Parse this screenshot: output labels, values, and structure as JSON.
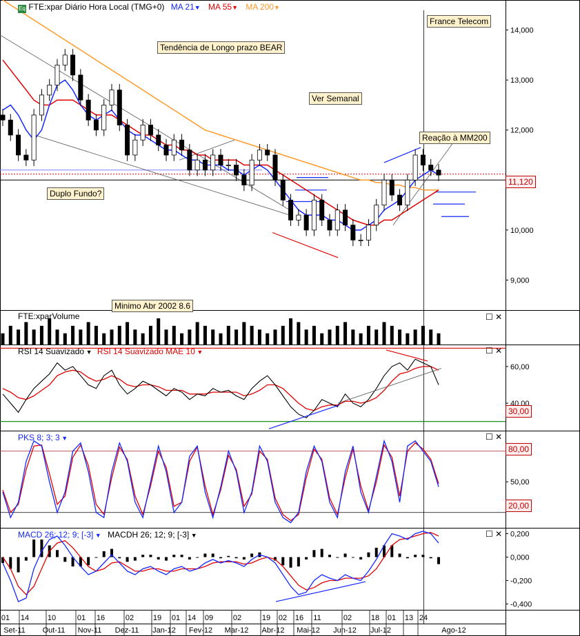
{
  "colors": {
    "ma21": "#1428ff",
    "ma55": "#e00000",
    "ma200": "#ff9a2a",
    "candle": "#000000",
    "note_bg": "#fff2cc",
    "price_tag_bg": "#ffecec",
    "price_tag_border": "#c00000",
    "rsi_main": "#000000",
    "rsi_signal": "#e00000",
    "pks_main": "#1428ff",
    "pks_signal": "#e00000",
    "macd_main": "#1428ff",
    "macd_signal": "#e00000",
    "level_red": "#e00000",
    "level_green": "#008000"
  },
  "header": {
    "instrument": "FTE:xpar Diário Hora Local (TMG+0)",
    "ma21": "MA 21",
    "ma55": "MA 55",
    "ma200": "MA 200"
  },
  "annotations": {
    "company": "France Telecom",
    "trend": "Tendência de Longo prazo BEAR",
    "weekly": "Ver Semanal",
    "reaction": "Reação à MM200",
    "double_bottom": "Duplo Fundo?",
    "minimum": "Minimo Abr 2002 8.6"
  },
  "price_tag": "11,120",
  "panels": {
    "volume": {
      "title": "FTE:xparVolume"
    },
    "rsi": {
      "title1": "RSI 14 Suavizado",
      "title2": "RSI 14 Suavizado MAE 10",
      "level_tag": "30,00"
    },
    "pks": {
      "title": "PKS 8; 3; 3",
      "tag_high": "80,00",
      "tag_low": "20,00"
    },
    "macd": {
      "title1": "MACD 26; 12; 9; [-3]",
      "title2": "MACDH 26; 12; 9; [-3]"
    }
  },
  "chart_data": [
    {
      "type": "line",
      "title": "FTE:xpar Diário Hora Local (TMG+0)",
      "chart": "candlestick",
      "y_axis_ticks": [
        "9,000",
        "10,000",
        "11,000",
        "12,000",
        "13,000",
        "14,000"
      ],
      "ylim": [
        8.4,
        14.6
      ],
      "last_price": 11.12,
      "x_day_ticks": [
        "01",
        "14",
        "10",
        "01",
        "16",
        "02",
        "19",
        "01",
        "14",
        "09",
        "02",
        "19",
        "02",
        "16",
        "11",
        "02",
        "18",
        "01",
        "13",
        "24"
      ],
      "x_month_ticks": [
        "Set-11",
        "Out-11",
        "Nov-11",
        "Dez-11",
        "Jan-12",
        "Fev-12",
        "Mar-12",
        "Abr-12",
        "Mai-12",
        "Jun-12",
        "Jul-12",
        "Ago-12"
      ],
      "series": [
        {
          "name": "MA 21"
        },
        {
          "name": "MA 55"
        },
        {
          "name": "MA 200"
        }
      ],
      "close_approx": [
        12.2,
        11.9,
        11.5,
        11.4,
        12.3,
        12.7,
        12.9,
        13.3,
        13.5,
        13.1,
        12.6,
        12.2,
        12.0,
        12.5,
        12.8,
        12.1,
        11.5,
        11.8,
        12.1,
        11.9,
        11.7,
        11.5,
        11.8,
        11.6,
        11.2,
        11.4,
        11.2,
        11.5,
        11.3,
        11.3,
        11.1,
        10.9,
        11.4,
        11.6,
        11.5,
        11.0,
        10.6,
        10.2,
        10.3,
        10.0,
        10.6,
        10.2,
        10.0,
        10.4,
        10.1,
        9.8,
        9.8,
        10.1,
        10.5,
        11.0,
        10.7,
        10.5,
        11.0,
        11.5,
        11.3,
        11.2,
        11.1
      ],
      "ma21_approx": [
        12.4,
        12.5,
        12.3,
        12.0,
        11.8,
        12.0,
        12.5,
        12.9,
        13.0,
        12.8,
        12.5,
        12.3,
        12.2,
        12.3,
        12.4,
        12.2,
        12.0,
        11.9,
        11.9,
        11.8,
        11.7,
        11.6,
        11.6,
        11.5,
        11.4,
        11.4,
        11.3,
        11.3,
        11.3,
        11.2,
        11.2,
        11.1,
        11.2,
        11.3,
        11.2,
        11.0,
        10.8,
        10.6,
        10.4,
        10.3,
        10.3,
        10.3,
        10.2,
        10.2,
        10.1,
        10.0,
        10.0,
        10.1,
        10.2,
        10.4,
        10.5,
        10.6,
        10.8,
        11.0,
        11.1,
        11.2,
        11.1
      ],
      "ma55_approx": [
        13.4,
        13.2,
        13.0,
        12.8,
        12.6,
        12.5,
        12.5,
        12.6,
        12.6,
        12.6,
        12.5,
        12.4,
        12.3,
        12.3,
        12.3,
        12.2,
        12.1,
        12.0,
        11.9,
        11.9,
        11.8,
        11.7,
        11.7,
        11.6,
        11.6,
        11.5,
        11.5,
        11.4,
        11.4,
        11.4,
        11.4,
        11.3,
        11.3,
        11.3,
        11.3,
        11.2,
        11.1,
        11.0,
        10.9,
        10.8,
        10.7,
        10.6,
        10.5,
        10.4,
        10.3,
        10.2,
        10.15,
        10.1,
        10.1,
        10.2,
        10.2,
        10.3,
        10.4,
        10.5,
        10.6,
        10.7,
        10.8
      ],
      "ma200_approx": [
        14.6,
        14.5,
        14.4,
        14.3,
        14.2,
        14.1,
        14.0,
        13.9,
        13.8,
        13.7,
        13.6,
        13.5,
        13.4,
        13.3,
        13.2,
        13.1,
        13.0,
        12.9,
        12.8,
        12.7,
        12.6,
        12.5,
        12.4,
        12.3,
        12.2,
        12.1,
        12.0,
        11.95,
        11.9,
        11.85,
        11.8,
        11.75,
        11.7,
        11.65,
        11.6,
        11.55,
        11.5,
        11.45,
        11.4,
        11.35,
        11.3,
        11.25,
        11.2,
        11.15,
        11.1,
        11.05,
        11.0,
        11.0,
        10.95,
        10.95,
        10.9,
        10.9,
        10.85,
        10.85,
        10.8,
        10.8,
        10.8
      ]
    },
    {
      "type": "bar",
      "title": "FTE:xparVolume",
      "values": [
        3,
        5,
        4,
        6,
        4,
        5,
        7,
        4,
        3,
        5,
        4,
        6,
        5,
        3,
        4,
        5,
        6,
        4,
        3,
        5,
        7,
        4,
        5,
        3,
        4,
        6,
        5,
        4,
        3,
        5,
        4,
        6,
        5,
        4,
        3,
        4,
        5,
        7,
        6,
        4,
        5,
        3,
        4,
        5,
        6,
        4,
        3,
        5,
        4,
        6,
        5,
        4,
        3,
        4,
        5,
        4,
        3
      ]
    },
    {
      "type": "line",
      "title": "RSI 14 Suavizado",
      "ylim": [
        25,
        72
      ],
      "y_axis_ticks": [
        "40,00",
        "60,00"
      ],
      "levels": [
        70,
        30
      ],
      "series": [
        {
          "name": "RSI 14 Suavizado",
          "values": [
            45,
            40,
            35,
            42,
            48,
            52,
            56,
            62,
            58,
            60,
            55,
            50,
            48,
            55,
            58,
            50,
            45,
            48,
            52,
            50,
            47,
            44,
            48,
            46,
            42,
            45,
            44,
            48,
            46,
            47,
            44,
            42,
            48,
            52,
            55,
            50,
            44,
            38,
            34,
            32,
            36,
            42,
            40,
            38,
            45,
            40,
            38,
            42,
            48,
            55,
            60,
            62,
            58,
            64,
            62,
            60,
            50
          ]
        },
        {
          "name": "RSI 14 Suavizado MAE 10",
          "values": [
            48,
            46,
            43,
            42,
            44,
            47,
            50,
            55,
            57,
            58,
            57,
            54,
            52,
            53,
            55,
            53,
            50,
            49,
            50,
            50,
            49,
            47,
            47,
            47,
            45,
            45,
            45,
            46,
            46,
            46,
            46,
            44,
            45,
            47,
            50,
            50,
            48,
            44,
            40,
            37,
            36,
            38,
            39,
            39,
            41,
            41,
            40,
            41,
            43,
            47,
            52,
            56,
            57,
            59,
            60,
            60,
            58
          ]
        }
      ]
    },
    {
      "type": "line",
      "title": "PKS 8; 3; 3",
      "ylim": [
        5,
        100
      ],
      "y_axis_ticks": [
        "20,00",
        "50,00",
        "80,00"
      ],
      "levels": [
        80,
        20
      ],
      "series": [
        {
          "name": "PKS 8; 3; 3",
          "values": [
            40,
            15,
            30,
            70,
            90,
            85,
            50,
            20,
            40,
            80,
            88,
            60,
            20,
            15,
            60,
            88,
            70,
            30,
            15,
            50,
            85,
            60,
            20,
            30,
            75,
            85,
            40,
            15,
            45,
            80,
            60,
            20,
            40,
            85,
            70,
            30,
            15,
            10,
            20,
            60,
            85,
            70,
            30,
            15,
            60,
            85,
            40,
            20,
            55,
            90,
            70,
            30,
            85,
            90,
            80,
            70,
            45
          ]
        },
        {
          "name": "signal",
          "values": [
            42,
            20,
            28,
            62,
            85,
            86,
            58,
            28,
            36,
            74,
            86,
            66,
            28,
            18,
            54,
            84,
            72,
            36,
            18,
            46,
            80,
            64,
            26,
            30,
            70,
            84,
            46,
            18,
            42,
            76,
            62,
            26,
            38,
            80,
            72,
            34,
            18,
            12,
            18,
            54,
            82,
            72,
            34,
            18,
            54,
            82,
            46,
            22,
            50,
            86,
            74,
            36,
            80,
            88,
            82,
            72,
            48
          ]
        }
      ]
    },
    {
      "type": "line",
      "title": "MACD 26; 12; 9; [-3]",
      "ylim": [
        -0.45,
        0.25
      ],
      "y_axis_ticks": [
        "0,200",
        "0,000",
        "-0,200",
        "-0,400"
      ],
      "series": [
        {
          "name": "MACD 26; 12; 9; [-3]",
          "values": [
            -0.05,
            -0.2,
            -0.38,
            -0.35,
            -0.1,
            0.05,
            0.15,
            0.18,
            0.1,
            0.0,
            -0.08,
            -0.15,
            -0.12,
            -0.05,
            0.02,
            -0.05,
            -0.12,
            -0.15,
            -0.1,
            -0.08,
            -0.12,
            -0.15,
            -0.1,
            -0.08,
            -0.12,
            -0.1,
            -0.05,
            -0.02,
            -0.05,
            -0.03,
            -0.05,
            -0.08,
            -0.02,
            0.02,
            0.0,
            -0.05,
            -0.15,
            -0.25,
            -0.32,
            -0.3,
            -0.2,
            -0.15,
            -0.18,
            -0.2,
            -0.15,
            -0.18,
            -0.2,
            -0.12,
            -0.02,
            0.1,
            0.2,
            0.18,
            0.15,
            0.2,
            0.22,
            0.2,
            0.12
          ]
        },
        {
          "name": "signal",
          "values": [
            0.0,
            -0.1,
            -0.25,
            -0.32,
            -0.25,
            -0.1,
            0.05,
            0.12,
            0.14,
            0.08,
            0.0,
            -0.08,
            -0.12,
            -0.1,
            -0.05,
            -0.04,
            -0.08,
            -0.12,
            -0.12,
            -0.1,
            -0.1,
            -0.12,
            -0.12,
            -0.1,
            -0.1,
            -0.1,
            -0.08,
            -0.05,
            -0.04,
            -0.04,
            -0.04,
            -0.06,
            -0.05,
            -0.02,
            0.0,
            -0.02,
            -0.08,
            -0.16,
            -0.24,
            -0.28,
            -0.26,
            -0.22,
            -0.2,
            -0.2,
            -0.18,
            -0.18,
            -0.18,
            -0.16,
            -0.1,
            0.0,
            0.1,
            0.15,
            0.16,
            0.18,
            0.2,
            0.21,
            0.18
          ]
        },
        {
          "name": "MACDH 26; 12; 9; [-3]",
          "values": [
            -0.05,
            -0.1,
            -0.13,
            -0.03,
            0.15,
            0.15,
            0.1,
            0.06,
            -0.04,
            -0.08,
            -0.08,
            -0.07,
            0.0,
            0.05,
            0.07,
            -0.01,
            -0.04,
            -0.03,
            0.02,
            0.02,
            -0.02,
            -0.03,
            0.02,
            0.02,
            -0.02,
            0.0,
            0.03,
            0.03,
            -0.01,
            0.01,
            -0.01,
            -0.02,
            0.03,
            0.04,
            0.0,
            -0.03,
            -0.07,
            -0.09,
            -0.08,
            -0.02,
            0.06,
            0.07,
            0.02,
            0.0,
            0.03,
            0.0,
            -0.02,
            0.04,
            0.08,
            0.1,
            0.1,
            0.03,
            -0.01,
            0.02,
            0.02,
            -0.01,
            -0.06
          ]
        }
      ]
    }
  ]
}
